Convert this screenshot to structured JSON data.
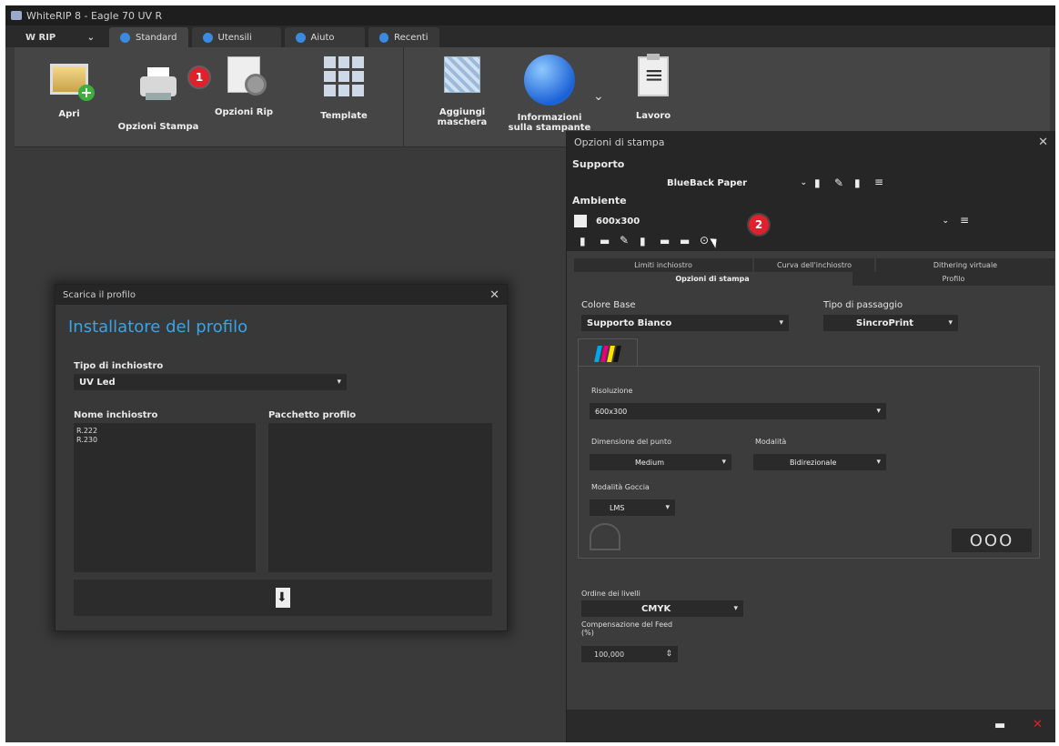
{
  "window": {
    "title": "WhiteRIP 8 - Eagle 70 UV R"
  },
  "menu": {
    "label": "W RIP",
    "chevron": "chevron-down-icon"
  },
  "tabs": [
    {
      "label": "Standard",
      "icon": "home-icon"
    },
    {
      "label": "Utensili",
      "icon": "tools-icon"
    },
    {
      "label": "Aiuto",
      "icon": "help-icon"
    },
    {
      "label": "Recenti",
      "icon": "recent-icon"
    }
  ],
  "ribbon": {
    "open": "Apri",
    "print_options": "Opzioni Stampa",
    "rip_options": "Opzioni Rip",
    "template": "Template",
    "add_mask": "Aggiungi maschera",
    "printer_info_l1": "Informazioni",
    "printer_info_l2": "sulla stampante",
    "job": "Lavoro",
    "badge1": "1"
  },
  "profile_dialog": {
    "title": "Scarica il profilo",
    "heading": "Installatore del profilo",
    "ink_type_label": "Tipo di inchiostro",
    "ink_type_value": "UV Led",
    "ink_name_label": "Nome inchiostro",
    "ink_names": [
      "R.222",
      "R.230"
    ],
    "profile_pack_label": "Pacchetto profilo"
  },
  "print_dialog": {
    "title": "Opzioni di stampa",
    "support_label": "Supporto",
    "support_value": "BlueBack Paper",
    "env_label": "Ambiente",
    "env_value": "600x300",
    "badge2": "2",
    "subtabs": {
      "ink_limit": "Limiti inchiostro",
      "ink_curve": "Curva dell'inchiostro",
      "virtual_dither": "Dithering virtuale",
      "print_options": "Opzioni di stampa",
      "profile": "Profilo"
    },
    "base_color_label": "Colore Base",
    "base_color_value": "Supporto Bianco",
    "pass_type_label": "Tipo di passaggio",
    "pass_type_value": "SincroPrint",
    "resolution_label": "Risoluzione",
    "resolution_value": "600x300",
    "dot_size_label": "Dimensione del punto",
    "dot_size_value": "Medium",
    "mode_label": "Modalità",
    "mode_value": "Bidirezionale",
    "drop_mode_label": "Modalità Goccia",
    "drop_mode_value": "LMS",
    "dots_button": "OOO",
    "layer_order_label": "Ordine dei livelli",
    "layer_order_value": "CMYK",
    "feed_comp_label_l1": "Compensazione del Feed",
    "feed_comp_label_l2": "(%)",
    "feed_comp_value": "100,000"
  },
  "colors": {
    "accent_blue": "#3aa3e8",
    "badge_red": "#e0202a",
    "cmyk_c": "#00a8e8",
    "cmyk_m": "#e6007e",
    "cmyk_y": "#ffe100",
    "cmyk_k": "#111111"
  }
}
